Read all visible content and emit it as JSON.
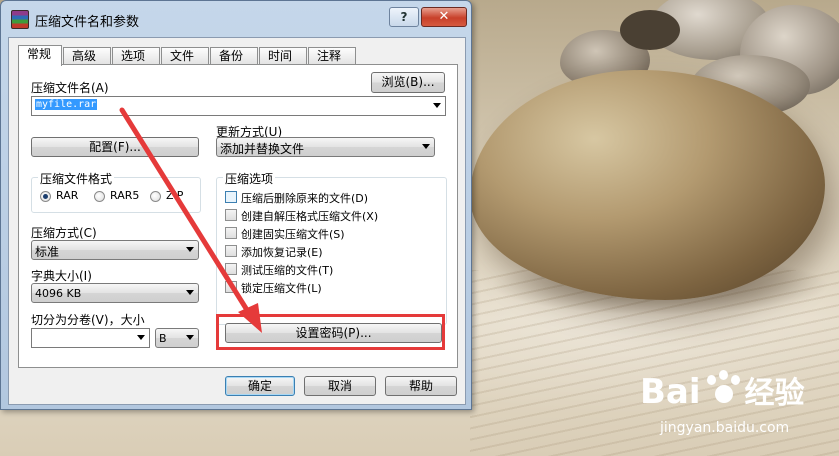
{
  "window": {
    "title": "压缩文件名和参数",
    "help_label": "?",
    "close_label": "✕"
  },
  "tabs": [
    {
      "label": "常规",
      "active": true
    },
    {
      "label": "高级"
    },
    {
      "label": "选项"
    },
    {
      "label": "文件"
    },
    {
      "label": "备份"
    },
    {
      "label": "时间"
    },
    {
      "label": "注释"
    }
  ],
  "general": {
    "archive_name_label": "压缩文件名(A)",
    "browse_button": "浏览(B)...",
    "archive_name_value": "myfile.rar",
    "update_mode_label": "更新方式(U)",
    "update_mode_value": "添加并替换文件",
    "profiles_button": "配置(F)...",
    "format_group_title": "压缩文件格式",
    "formats": [
      {
        "label": "RAR",
        "selected": true
      },
      {
        "label": "RAR5",
        "selected": false
      },
      {
        "label": "ZIP",
        "selected": false
      }
    ],
    "method_label": "压缩方式(C)",
    "method_value": "标准",
    "dict_label": "字典大小(I)",
    "dict_value": "4096 KB",
    "split_label": "切分为分卷(V)，大小",
    "split_value": "",
    "split_unit": "B",
    "options_group_title": "压缩选项",
    "options": [
      {
        "label": "压缩后删除原来的文件(D)",
        "checked": false
      },
      {
        "label": "创建自解压格式压缩文件(X)",
        "checked": false
      },
      {
        "label": "创建固实压缩文件(S)",
        "checked": false
      },
      {
        "label": "添加恢复记录(E)",
        "checked": false
      },
      {
        "label": "测试压缩的文件(T)",
        "checked": false
      },
      {
        "label": "锁定压缩文件(L)",
        "checked": false
      }
    ],
    "set_password_button": "设置密码(P)..."
  },
  "footer": {
    "ok": "确定",
    "cancel": "取消",
    "help": "帮助"
  },
  "watermark": {
    "logo_text": "Bai",
    "brand_text": "经验",
    "url": "jingyan.baidu.com"
  },
  "colors": {
    "annotation_red": "#e53a3a",
    "selection_blue": "#3399ff"
  }
}
